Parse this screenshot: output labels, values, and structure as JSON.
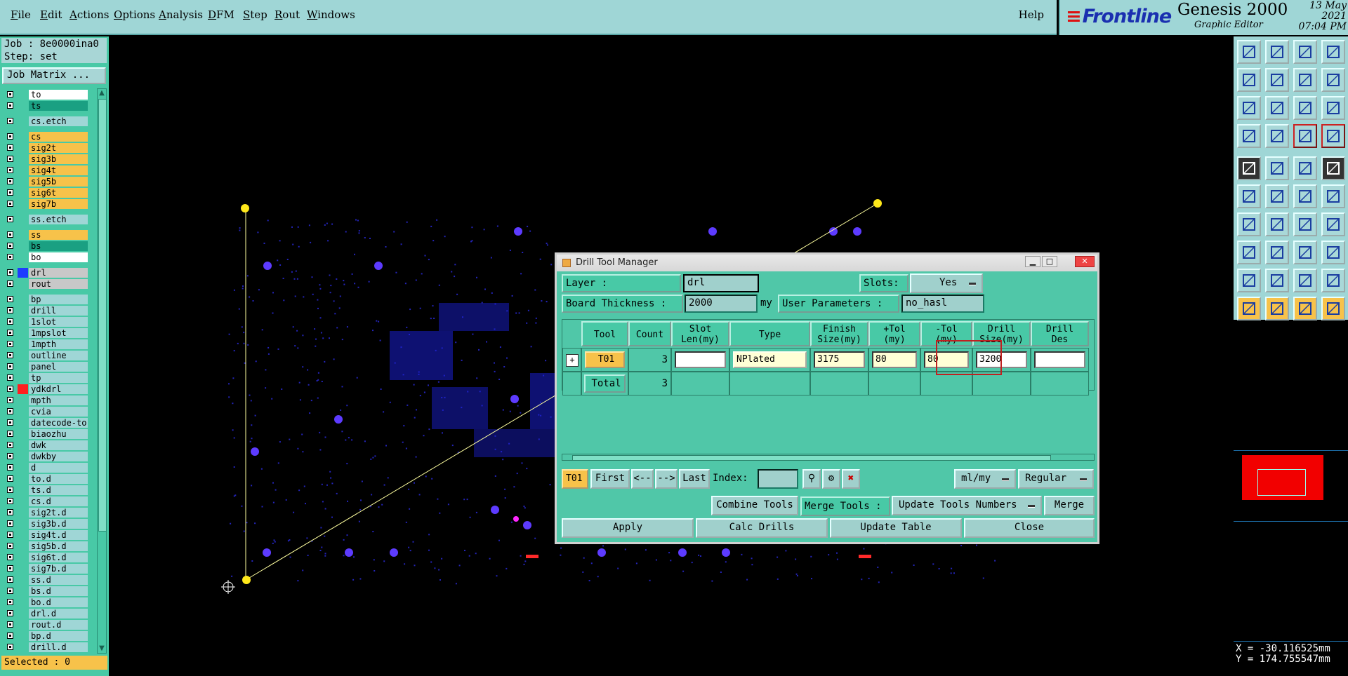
{
  "menu": {
    "items": [
      "File",
      "Edit",
      "Actions",
      "Options",
      "Analysis",
      "DFM",
      "Step",
      "Rout",
      "Windows"
    ],
    "help": "Help"
  },
  "brand": {
    "logo": "Frontline",
    "product": "Genesis 2000",
    "subtitle": "Graphic Editor",
    "date": "13 May 2021",
    "time": "07:04 PM"
  },
  "left": {
    "job": "Job : 8e0000ina0",
    "step": "Step: set",
    "job_matrix": "Job Matrix ...",
    "selected": "Selected : 0",
    "layers": [
      {
        "name": "to",
        "color": "#ffffff"
      },
      {
        "name": "ts",
        "color": "#1aa082"
      },
      {
        "name": "cs.etch",
        "color": "#9fd6d6"
      },
      {
        "name": "cs",
        "color": "#f7c24a"
      },
      {
        "name": "sig2t",
        "color": "#f7c24a"
      },
      {
        "name": "sig3b",
        "color": "#f7c24a"
      },
      {
        "name": "sig4t",
        "color": "#f7c24a"
      },
      {
        "name": "sig5b",
        "color": "#f7c24a"
      },
      {
        "name": "sig6t",
        "color": "#f7c24a"
      },
      {
        "name": "sig7b",
        "color": "#f7c24a"
      },
      {
        "name": "ss.etch",
        "color": "#9fd6d6"
      },
      {
        "name": "ss",
        "color": "#f7c24a"
      },
      {
        "name": "bs",
        "color": "#1aa082"
      },
      {
        "name": "bo",
        "color": "#ffffff"
      },
      {
        "name": "drl",
        "color": "#c8c8c8",
        "swatch": "#1e3cff"
      },
      {
        "name": "rout",
        "color": "#c8c8c8"
      },
      {
        "name": "bp",
        "color": "#9fd6d6"
      },
      {
        "name": "drill",
        "color": "#9fd6d6"
      },
      {
        "name": "1slot",
        "color": "#9fd6d6"
      },
      {
        "name": "1mpslot",
        "color": "#9fd6d6"
      },
      {
        "name": "1mpth",
        "color": "#9fd6d6"
      },
      {
        "name": "outline",
        "color": "#9fd6d6"
      },
      {
        "name": "panel",
        "color": "#9fd6d6"
      },
      {
        "name": "tp",
        "color": "#9fd6d6"
      },
      {
        "name": "ydkdrl",
        "color": "#9fd6d6",
        "swatch": "#ff2020"
      },
      {
        "name": "mpth",
        "color": "#9fd6d6"
      },
      {
        "name": "cvia",
        "color": "#9fd6d6"
      },
      {
        "name": "datecode-to",
        "color": "#9fd6d6"
      },
      {
        "name": "biaozhu",
        "color": "#9fd6d6"
      },
      {
        "name": "dwk",
        "color": "#9fd6d6"
      },
      {
        "name": "dwkby",
        "color": "#9fd6d6"
      },
      {
        "name": "d",
        "color": "#9fd6d6"
      },
      {
        "name": "to.d",
        "color": "#9fd6d6"
      },
      {
        "name": "ts.d",
        "color": "#9fd6d6"
      },
      {
        "name": "cs.d",
        "color": "#9fd6d6"
      },
      {
        "name": "sig2t.d",
        "color": "#9fd6d6"
      },
      {
        "name": "sig3b.d",
        "color": "#9fd6d6"
      },
      {
        "name": "sig4t.d",
        "color": "#9fd6d6"
      },
      {
        "name": "sig5b.d",
        "color": "#9fd6d6"
      },
      {
        "name": "sig6t.d",
        "color": "#9fd6d6"
      },
      {
        "name": "sig7b.d",
        "color": "#9fd6d6"
      },
      {
        "name": "ss.d",
        "color": "#9fd6d6"
      },
      {
        "name": "bs.d",
        "color": "#9fd6d6"
      },
      {
        "name": "bo.d",
        "color": "#9fd6d6"
      },
      {
        "name": "drl.d",
        "color": "#9fd6d6"
      },
      {
        "name": "rout.d",
        "color": "#9fd6d6"
      },
      {
        "name": "bp.d",
        "color": "#9fd6d6"
      },
      {
        "name": "drill.d",
        "color": "#9fd6d6"
      }
    ]
  },
  "coords": {
    "x": "X = -30.116525mm",
    "y": "Y = 174.755547mm"
  },
  "dialog": {
    "title": "Drill Tool Manager",
    "layer_label": "Layer          :",
    "layer_value": "drl",
    "slots_label": "Slots:",
    "slots_value": "Yes",
    "board_thickness_label": "Board Thickness :",
    "board_thickness_value": "2000",
    "board_thickness_unit": "my",
    "user_params_label": "User Parameters :",
    "user_params_value": "no_hasl",
    "headers": {
      "tool": "Tool",
      "count": "Count",
      "slot_len": "Slot\nLen(my)",
      "type": "Type",
      "finish": "Finish\nSize(my)",
      "plus_tol": "+Tol\n(my)",
      "minus_tol": "-Tol\n(my)",
      "drill_size": "Drill\nSize(my)",
      "drill_des": "Drill\nDes"
    },
    "row": {
      "tool": "T01",
      "count": "3",
      "slot_len": "",
      "type": "NPlated",
      "finish": "3175",
      "plus_tol": "80",
      "minus_tol": "80",
      "drill_size": "3200",
      "drill_des": ""
    },
    "total_label": "Total",
    "total_count": "3",
    "nav": {
      "current": "T01",
      "first": "First",
      "prev": "<--",
      "next": "-->",
      "last": "Last",
      "index_label": "Index:",
      "units": "ml/my",
      "mode": "Regular"
    },
    "combine_tools": "Combine Tools",
    "merge_tools_label": "Merge Tools :",
    "merge_option": "Update Tools Numbers",
    "merge": "Merge",
    "apply": "Apply",
    "calc_drills": "Calc Drills",
    "update_table": "Update Table",
    "close": "Close"
  }
}
